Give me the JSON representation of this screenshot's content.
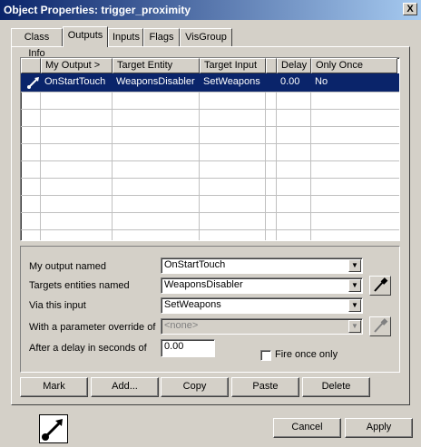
{
  "window": {
    "title": "Object Properties: trigger_proximity",
    "close_label": "X"
  },
  "tabs": [
    {
      "label": "Class Info"
    },
    {
      "label": "Outputs"
    },
    {
      "label": "Inputs"
    },
    {
      "label": "Flags"
    },
    {
      "label": "VisGroup"
    }
  ],
  "table": {
    "columns": [
      "My Output >",
      "Target Entity",
      "Target Input",
      "Delay",
      "Only Once"
    ],
    "rows": [
      {
        "output": "OnStartTouch",
        "target": "WeaponsDisabler",
        "input": "SetWeapons",
        "delay": "0.00",
        "once": "No"
      }
    ]
  },
  "form": {
    "output_label": "My output named",
    "output_value": "OnStartTouch",
    "targets_label": "Targets entities named",
    "targets_value": "WeaponsDisabler",
    "input_label": "Via this input",
    "input_value": "SetWeapons",
    "param_label": "With a parameter override of",
    "param_value": "<none>",
    "delay_label": "After a delay in seconds of",
    "delay_value": "0.00",
    "fire_once_label": "Fire once only"
  },
  "actions": [
    "Mark",
    "Add...",
    "Copy",
    "Paste",
    "Delete"
  ],
  "footer": {
    "cancel": "Cancel",
    "apply": "Apply"
  },
  "icons": {
    "output_icon": "arrow-connection-icon",
    "picker_icon": "eyedropper-icon"
  }
}
